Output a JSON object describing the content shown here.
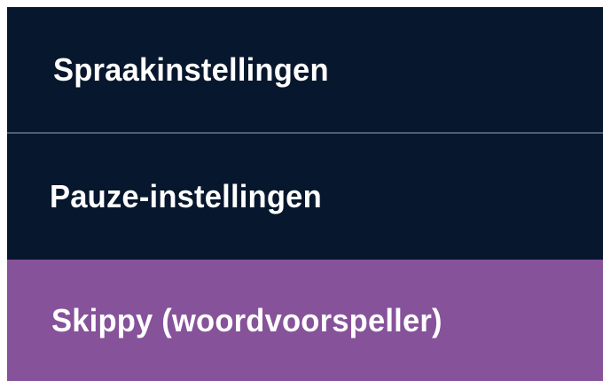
{
  "menu": {
    "items": [
      {
        "label": "Spraakinstellingen",
        "selected": false
      },
      {
        "label": "Pauze-instellingen",
        "selected": false
      },
      {
        "label": "Skippy (woordvoorspeller)",
        "selected": true
      }
    ],
    "colors": {
      "background": "#07172d",
      "selected_background": "#86529a",
      "divider": "#4e5e72",
      "text": "#ffffff"
    }
  }
}
